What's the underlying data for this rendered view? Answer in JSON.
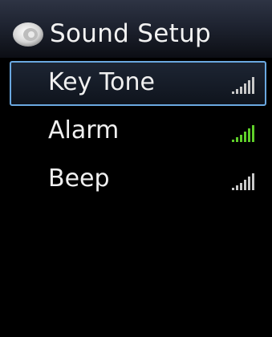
{
  "header": {
    "title": "Sound Setup",
    "icon": "speaker-icon"
  },
  "menu": {
    "items": [
      {
        "label": "Key Tone",
        "selected": true,
        "level_icon": "signal-bars-icon",
        "bar_color": "#c8c8c8"
      },
      {
        "label": "Alarm",
        "selected": false,
        "level_icon": "signal-bars-icon",
        "bar_color": "#5fcf2a"
      },
      {
        "label": "Beep",
        "selected": false,
        "level_icon": "signal-bars-icon",
        "bar_color": "#c8c8c8"
      }
    ]
  },
  "colors": {
    "background": "#000000",
    "selection_border": "#6aa8e0",
    "text": "#f0f0f0"
  }
}
